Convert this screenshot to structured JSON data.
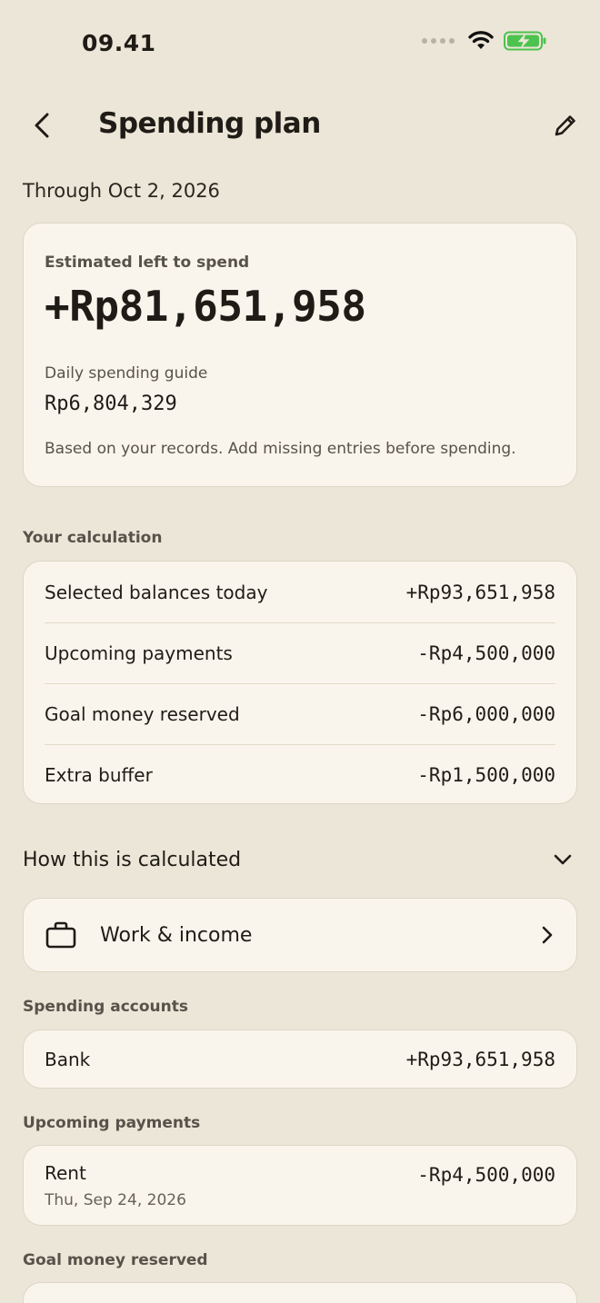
{
  "status_bar": {
    "time": "09.41"
  },
  "header": {
    "title": "Spending plan"
  },
  "period": "Through Oct 2, 2026",
  "summary": {
    "label": "Estimated left to spend",
    "amount": "+Rp81,651,958",
    "daily_label": "Daily spending guide",
    "daily_amount": "Rp6,804,329",
    "note": "Based on your records. Add missing entries before spending."
  },
  "calculation": {
    "section_label": "Your calculation",
    "rows": [
      {
        "label": "Selected balances today",
        "value": "+Rp93,651,958"
      },
      {
        "label": "Upcoming payments",
        "value": "-Rp4,500,000"
      },
      {
        "label": "Goal money reserved",
        "value": "-Rp6,000,000"
      },
      {
        "label": "Extra buffer",
        "value": "-Rp1,500,000"
      }
    ]
  },
  "how_calculated": {
    "label": "How this is calculated"
  },
  "work_income": {
    "label": "Work & income"
  },
  "spending_accounts": {
    "section_label": "Spending accounts",
    "items": [
      {
        "label": "Bank",
        "value": "+Rp93,651,958"
      }
    ]
  },
  "upcoming_payments": {
    "section_label": "Upcoming payments",
    "items": [
      {
        "label": "Rent",
        "date": "Thu, Sep 24, 2026",
        "value": "-Rp4,500,000"
      }
    ]
  },
  "goal_money": {
    "section_label": "Goal money reserved"
  },
  "colors": {
    "background": "#ECE6D8",
    "card": "#FAF5EC",
    "battery": "#4CC34E"
  }
}
